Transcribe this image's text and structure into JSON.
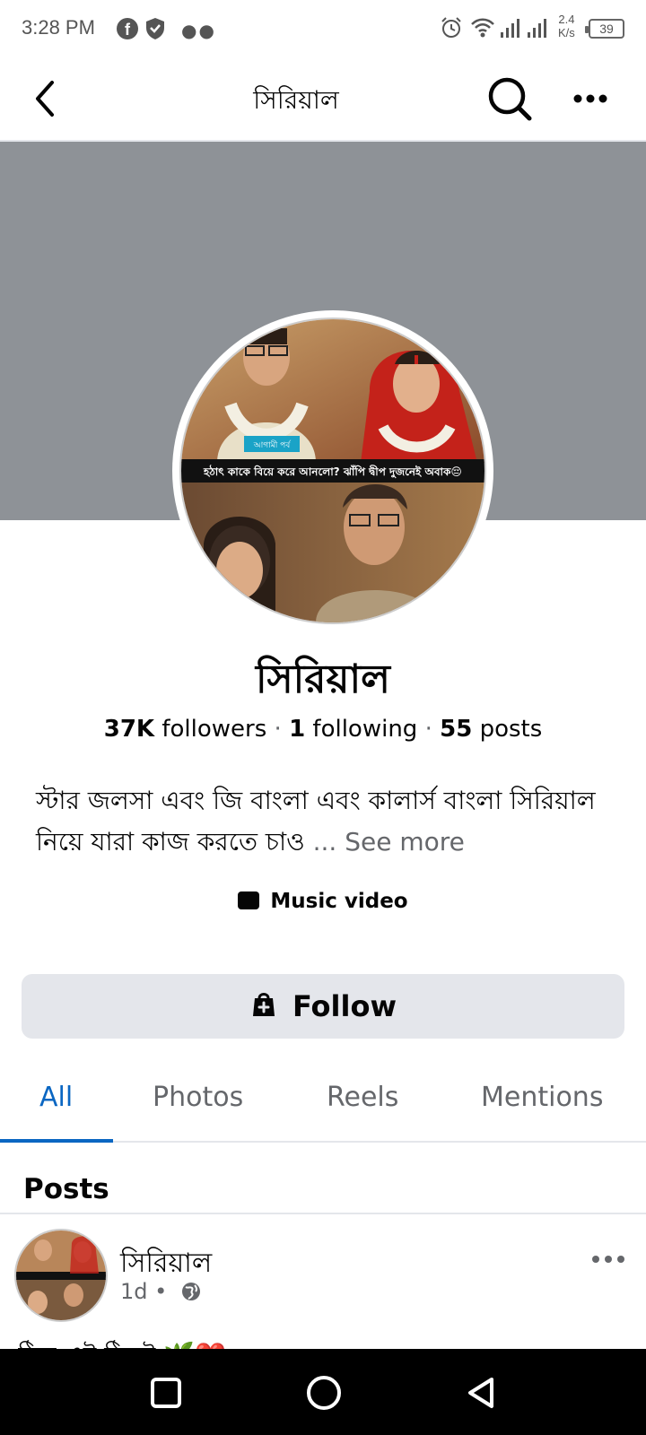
{
  "status_bar": {
    "time": "3:28 PM",
    "fb_icon": "f",
    "net_speed_value": "2.4",
    "net_speed_unit": "K/s",
    "battery": "39"
  },
  "header": {
    "title": "সিরিয়াল",
    "icons": [
      "back-icon",
      "search-icon",
      "more-icon"
    ]
  },
  "page": {
    "name": "সিরিয়াল",
    "followers_count": "37K",
    "followers_label": "followers",
    "following_count": "1",
    "following_label": "following",
    "posts_count": "55",
    "posts_label": "posts",
    "separator": "·",
    "bio": "স্টার জলসা এবং জি বাংলা এবং কালার্স বাংলা সিরিয়াল নিয়ে যারা কাজ করতে চাও",
    "see_more": "... See more",
    "category": "Music video"
  },
  "photo_caption": {
    "tag": "আগামী পর্ব",
    "headline": "হঠাৎ কাকে বিয়ে করে আনলো? ঝাঁপি দ্বীপ দুজনেই অবাক😔"
  },
  "follow_button": {
    "label": "Follow"
  },
  "tabs": [
    {
      "label": "All",
      "active": true
    },
    {
      "label": "Photos",
      "active": false
    },
    {
      "label": "Reels",
      "active": false
    },
    {
      "label": "Mentions",
      "active": false
    }
  ],
  "posts_section": {
    "heading": "Posts",
    "post": {
      "author": "সিরিয়াল",
      "time": "1d",
      "bullet": "•",
      "text_peek": "ঠিক এই ঠিকই 🌿❤️"
    }
  },
  "colors": {
    "accent": "#0a66c2",
    "cover": "#8e9297",
    "button_bg": "#e4e6eb",
    "secondary_text": "#65676b"
  }
}
